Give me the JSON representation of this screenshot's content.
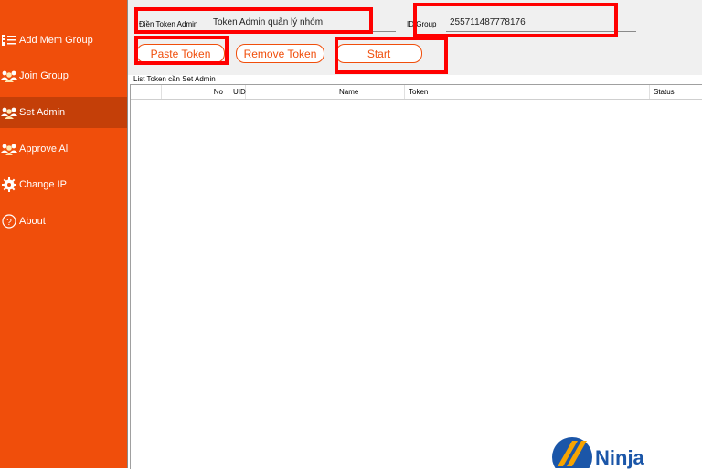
{
  "sidebar": {
    "items": [
      {
        "label": "Add Mem Group",
        "icon": "list-icon"
      },
      {
        "label": "Join Group",
        "icon": "group-icon"
      },
      {
        "label": "Set Admin",
        "icon": "group-icon",
        "active": true
      },
      {
        "label": "Approve All",
        "icon": "group-icon"
      },
      {
        "label": "Change IP",
        "icon": "gear-icon"
      },
      {
        "label": "About",
        "icon": "help-circle-icon"
      }
    ]
  },
  "form": {
    "token_label": "Điền Token Admin",
    "token_value": "Token Admin quản lý nhóm",
    "group_label": "ID Group",
    "group_value": "255711487778176"
  },
  "buttons": {
    "paste": "Paste Token",
    "remove": "Remove Token",
    "start": "Start"
  },
  "list": {
    "title": "List Token cần Set Admin",
    "columns": [
      "No",
      "UID",
      "Name",
      "Token",
      "Status"
    ]
  },
  "logo": {
    "text": "Ninja"
  },
  "colors": {
    "accent": "#f04e0b",
    "active": "#c43f08",
    "highlight": "#ff0000",
    "logo": "#1b56a8"
  }
}
